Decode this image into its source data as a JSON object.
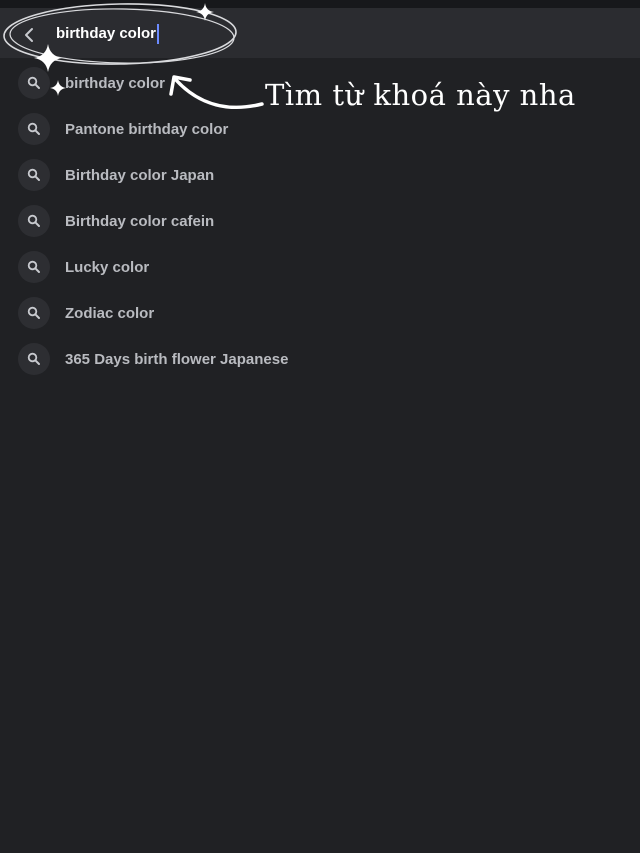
{
  "search": {
    "query": "birthday color",
    "icon": "chevron-left-icon"
  },
  "suggestions": [
    {
      "label": "birthday color",
      "icon": "search-icon"
    },
    {
      "label": "Pantone birthday color",
      "icon": "search-icon"
    },
    {
      "label": "Birthday color Japan",
      "icon": "search-icon"
    },
    {
      "label": "Birthday color cafein",
      "icon": "search-icon"
    },
    {
      "label": "Lucky color",
      "icon": "search-icon"
    },
    {
      "label": "Zodiac color",
      "icon": "search-icon"
    },
    {
      "label": "365 Days birth flower Japanese",
      "icon": "search-icon"
    }
  ],
  "annotation": {
    "text": "Tìm từ khoá này nha"
  },
  "colors": {
    "background": "#202124",
    "search_bar": "#2b2c30",
    "suggestion_text": "#b9bbc0",
    "caret": "#6c8bff"
  }
}
